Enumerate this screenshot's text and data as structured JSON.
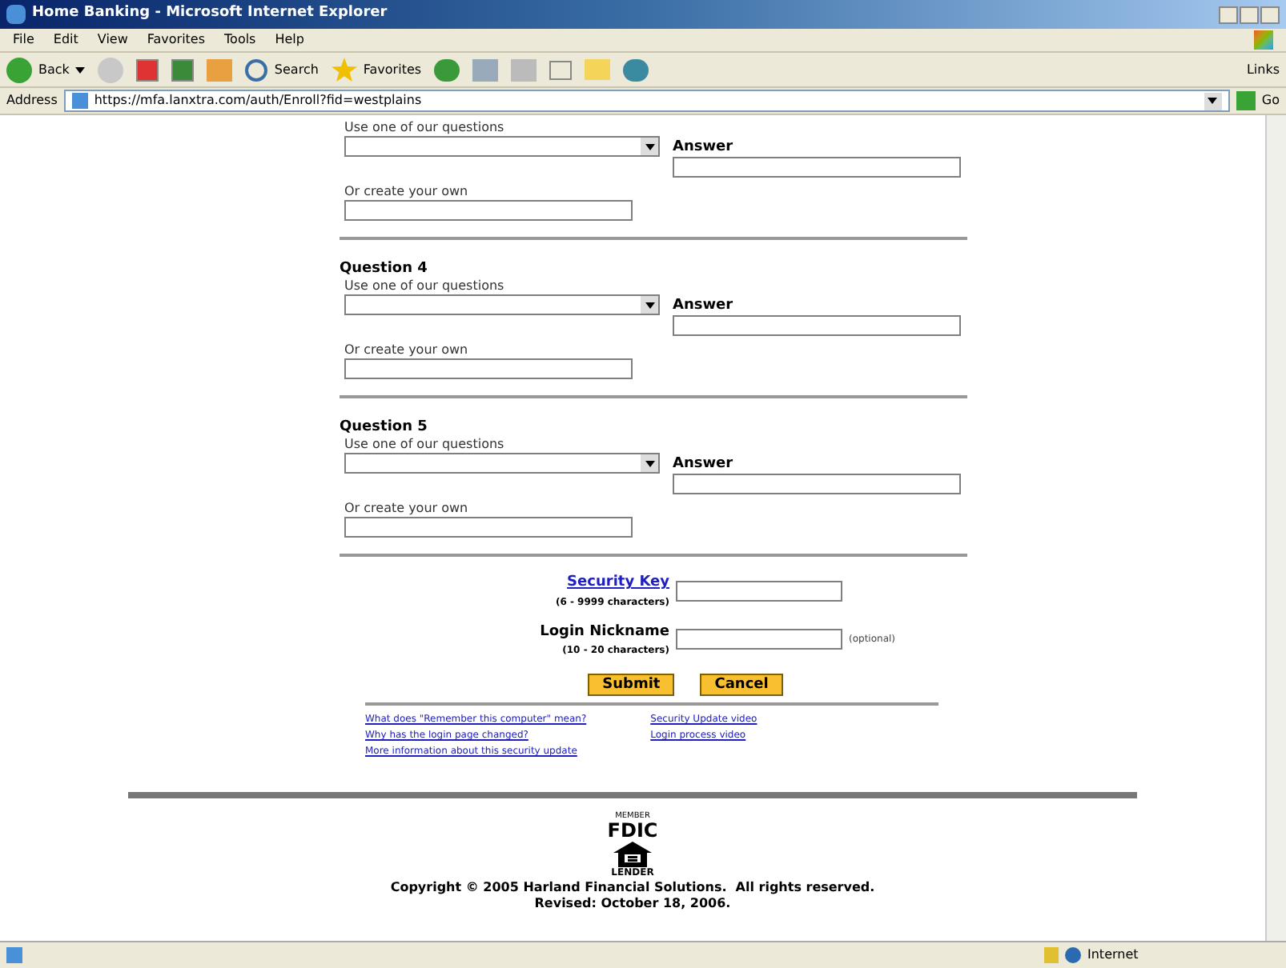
{
  "window": {
    "title": "Home Banking - Microsoft Internet Explorer"
  },
  "menu": [
    "File",
    "Edit",
    "View",
    "Favorites",
    "Tools",
    "Help"
  ],
  "toolbar": {
    "back": "Back",
    "search": "Search",
    "favorites": "Favorites",
    "links": "Links"
  },
  "address_bar": {
    "label": "Address",
    "url": "https://mfa.lanxtra.com/auth/Enroll?fid=westplains",
    "go": "Go"
  },
  "questions": [
    {
      "choose_label": "Use one of our questions",
      "answer_label": "Answer",
      "own_label": "Or create your own"
    },
    {
      "heading": "Question 4",
      "choose_label": "Use one of our questions",
      "answer_label": "Answer",
      "own_label": "Or create your own"
    },
    {
      "heading": "Question 5",
      "choose_label": "Use one of our questions",
      "answer_label": "Answer",
      "own_label": "Or create your own"
    }
  ],
  "credentials": [
    {
      "kind": "link",
      "label": "Security Key",
      "hint": "(6 - 9999 characters)"
    },
    {
      "kind": "plain",
      "label": "Login Nickname",
      "hint": "(10 - 20 characters)",
      "note": "(optional)"
    }
  ],
  "buttons": [
    "Submit",
    "Cancel"
  ],
  "links_left": [
    "What does \"Remember this computer\" mean?",
    "Why has the login page changed?",
    "More information about this security update"
  ],
  "links_right": [
    "Security Update video",
    "Login process video"
  ],
  "footer": {
    "member": "MEMBER",
    "fdic": "FDIC",
    "lender": "LENDER",
    "copyright": "Copyright © 2005 Harland Financial Solutions.  All rights reserved.",
    "revised": "Revised: October 18, 2006."
  },
  "status_bar": {
    "zone": "Internet"
  }
}
